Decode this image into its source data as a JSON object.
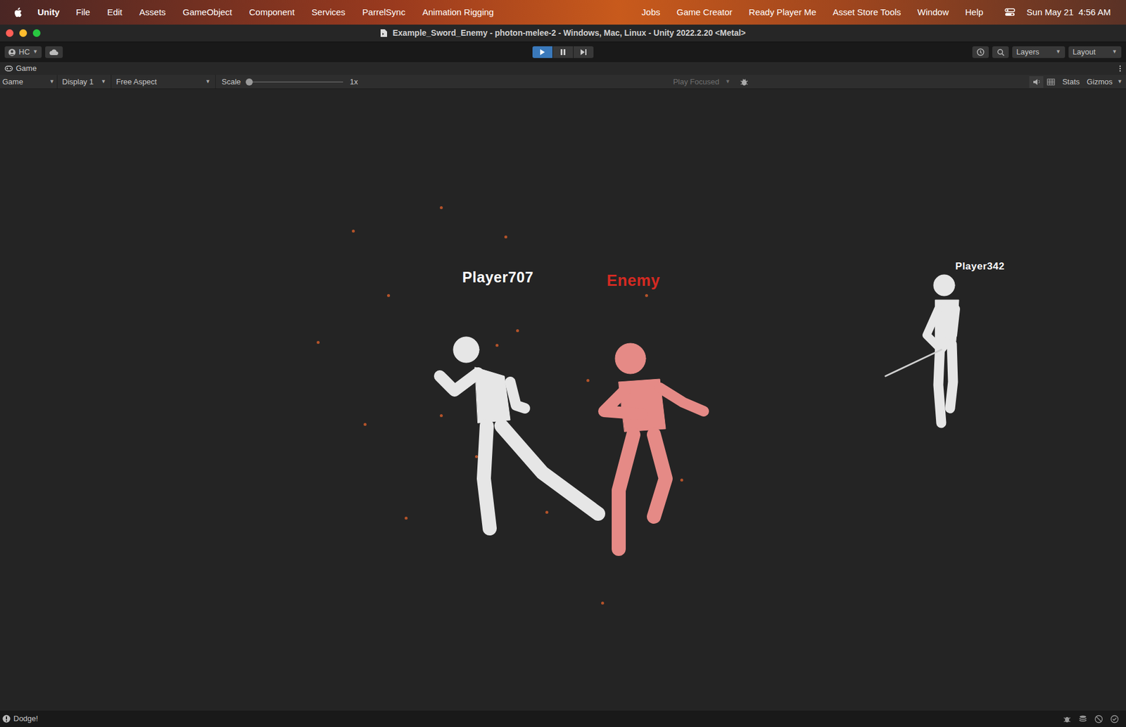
{
  "menu_bar": {
    "app_name": "Unity",
    "menus": [
      "File",
      "Edit",
      "Assets",
      "GameObject",
      "Component",
      "Services",
      "ParrelSync",
      "Animation Rigging"
    ],
    "right_menus": [
      "Jobs",
      "Game Creator",
      "Ready Player Me",
      "Asset Store Tools",
      "Window",
      "Help"
    ],
    "clock": "Sun May 21  4:56 AM"
  },
  "window": {
    "title": "Example_Sword_Enemy - photon-melee-2 - Windows, Mac, Linux - Unity 2022.2.20 <Metal>"
  },
  "toolbar": {
    "account": "HC",
    "playing": true,
    "paused": false,
    "layers": "Layers",
    "layout": "Layout"
  },
  "game_tab": {
    "label": "Game"
  },
  "game_toolbar": {
    "view": "Game",
    "display": "Display 1",
    "aspect": "Free Aspect",
    "scale_label": "Scale",
    "scale_level": 0,
    "scale_reading": "1x",
    "play_mode": "Play Focused",
    "stats": "Stats",
    "gizmos": "Gizmos"
  },
  "scene": {
    "characters": [
      {
        "name": "Player707",
        "kind": "player",
        "color": "#ffffff"
      },
      {
        "name": "Enemy",
        "kind": "enemy",
        "color": "#d42a22"
      },
      {
        "name": "Player342",
        "kind": "player",
        "color": "#ffffff"
      }
    ]
  },
  "status_bar": {
    "message": "Dodge!"
  }
}
